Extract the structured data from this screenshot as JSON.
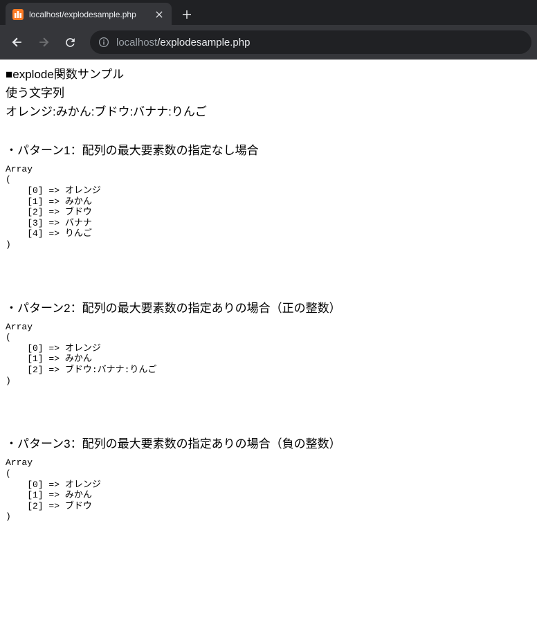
{
  "browser": {
    "tab": {
      "title": "localhost/explodesample.php"
    },
    "url": {
      "host": "localhost",
      "path": "/explodesample.php"
    }
  },
  "page": {
    "heading": "■explode関数サンプル",
    "subheading": "使う文字列",
    "sample_string": "オレンジ:みかん:ブドウ:バナナ:りんご",
    "patterns": [
      {
        "label": "・パターン1：配列の最大要素数の指定なし場合",
        "array_text": "Array\n(\n    [0] => オレンジ\n    [1] => みかん\n    [2] => ブドウ\n    [3] => バナナ\n    [4] => りんご\n)"
      },
      {
        "label": "・パターン2：配列の最大要素数の指定ありの場合（正の整数）",
        "array_text": "Array\n(\n    [0] => オレンジ\n    [1] => みかん\n    [2] => ブドウ:バナナ:りんご\n)"
      },
      {
        "label": "・パターン3：配列の最大要素数の指定ありの場合（負の整数）",
        "array_text": "Array\n(\n    [0] => オレンジ\n    [1] => みかん\n    [2] => ブドウ\n)"
      }
    ]
  }
}
